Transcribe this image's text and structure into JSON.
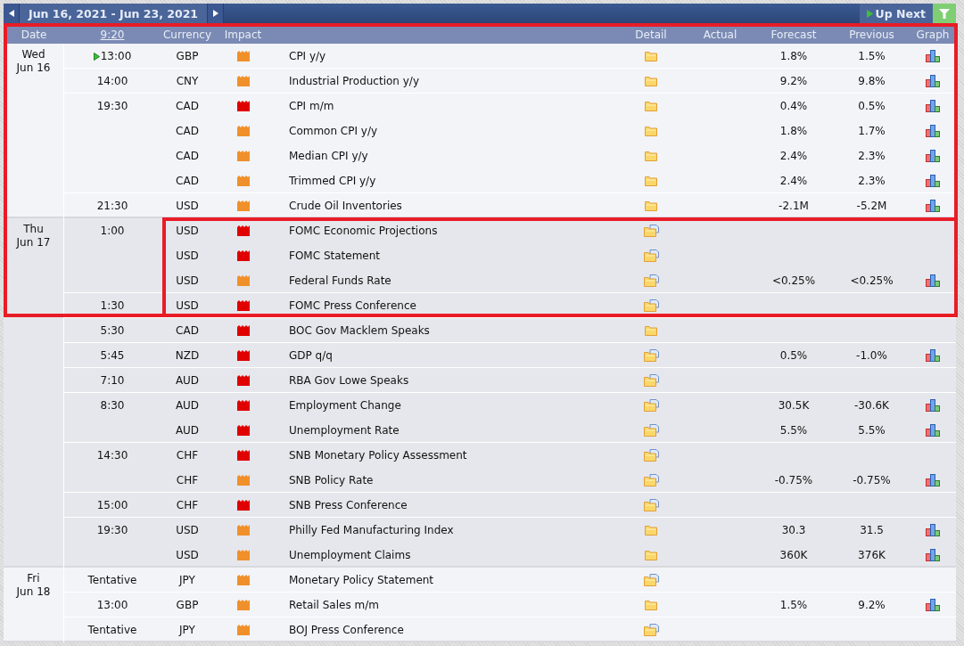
{
  "toolbar": {
    "range": "Jun 16, 2021 - Jun 23, 2021",
    "up_next": "Up Next"
  },
  "columns": {
    "date": "Date",
    "time": "9:20",
    "currency": "Currency",
    "impact": "Impact",
    "detail": "Detail",
    "actual": "Actual",
    "forecast": "Forecast",
    "previous": "Previous",
    "graph": "Graph"
  },
  "days": [
    {
      "weekday": "Wed",
      "date": "Jun 16",
      "groups": [
        {
          "time": "13:00",
          "upcoming": true,
          "events": [
            {
              "currency": "GBP",
              "impact": {
                "color": "#f0902a"
              },
              "title": "CPI y/y",
              "detail": {
                "kind": "folder"
              },
              "forecast": "1.8%",
              "previous": "1.5%",
              "graph": true
            }
          ]
        },
        {
          "time": "14:00",
          "upcoming": false,
          "events": [
            {
              "currency": "CNY",
              "impact": {
                "color": "#f0902a"
              },
              "title": "Industrial Production y/y",
              "detail": {
                "kind": "folder"
              },
              "forecast": "9.2%",
              "previous": "9.8%",
              "graph": true
            }
          ]
        },
        {
          "time": "19:30",
          "upcoming": false,
          "events": [
            {
              "currency": "CAD",
              "impact": {
                "color": "#e00000"
              },
              "title": "CPI m/m",
              "detail": {
                "kind": "folder"
              },
              "forecast": "0.4%",
              "previous": "0.5%",
              "graph": true
            },
            {
              "currency": "CAD",
              "impact": {
                "color": "#f0902a"
              },
              "title": "Common CPI y/y",
              "detail": {
                "kind": "folder"
              },
              "forecast": "1.8%",
              "previous": "1.7%",
              "graph": true
            },
            {
              "currency": "CAD",
              "impact": {
                "color": "#f0902a"
              },
              "title": "Median CPI y/y",
              "detail": {
                "kind": "folder"
              },
              "forecast": "2.4%",
              "previous": "2.3%",
              "graph": true
            },
            {
              "currency": "CAD",
              "impact": {
                "color": "#f0902a"
              },
              "title": "Trimmed CPI y/y",
              "detail": {
                "kind": "folder"
              },
              "forecast": "2.4%",
              "previous": "2.3%",
              "graph": true
            }
          ]
        },
        {
          "time": "21:30",
          "upcoming": false,
          "events": [
            {
              "currency": "USD",
              "impact": {
                "color": "#f0902a"
              },
              "title": "Crude Oil Inventories",
              "detail": {
                "kind": "folder"
              },
              "forecast": "-2.1M",
              "previous": "-5.2M",
              "graph": true
            }
          ]
        }
      ]
    },
    {
      "weekday": "Thu",
      "date": "Jun 17",
      "groups": [
        {
          "time": "1:00",
          "upcoming": false,
          "events": [
            {
              "currency": "USD",
              "impact": {
                "color": "#e00000"
              },
              "title": "FOMC Economic Projections",
              "detail": {
                "kind": "folder-doc"
              },
              "graph": false
            },
            {
              "currency": "USD",
              "impact": {
                "color": "#e00000"
              },
              "title": "FOMC Statement",
              "detail": {
                "kind": "folder-doc"
              },
              "graph": false
            },
            {
              "currency": "USD",
              "impact": {
                "color": "#f0902a"
              },
              "title": "Federal Funds Rate",
              "detail": {
                "kind": "folder-doc"
              },
              "forecast": "<0.25%",
              "previous": "<0.25%",
              "graph": true
            }
          ]
        },
        {
          "time": "1:30",
          "upcoming": false,
          "events": [
            {
              "currency": "USD",
              "impact": {
                "color": "#e00000"
              },
              "title": "FOMC Press Conference",
              "detail": {
                "kind": "folder-doc"
              },
              "graph": false
            }
          ]
        },
        {
          "time": "5:30",
          "upcoming": false,
          "events": [
            {
              "currency": "CAD",
              "impact": {
                "color": "#e00000"
              },
              "title": "BOC Gov Macklem Speaks",
              "detail": {
                "kind": "folder"
              },
              "graph": false
            }
          ]
        },
        {
          "time": "5:45",
          "upcoming": false,
          "events": [
            {
              "currency": "NZD",
              "impact": {
                "color": "#e00000"
              },
              "title": "GDP q/q",
              "detail": {
                "kind": "folder-doc"
              },
              "forecast": "0.5%",
              "previous": "-1.0%",
              "graph": true
            }
          ]
        },
        {
          "time": "7:10",
          "upcoming": false,
          "events": [
            {
              "currency": "AUD",
              "impact": {
                "color": "#e00000"
              },
              "title": "RBA Gov Lowe Speaks",
              "detail": {
                "kind": "folder-doc"
              },
              "graph": false
            }
          ]
        },
        {
          "time": "8:30",
          "upcoming": false,
          "events": [
            {
              "currency": "AUD",
              "impact": {
                "color": "#e00000"
              },
              "title": "Employment Change",
              "detail": {
                "kind": "folder-doc"
              },
              "forecast": "30.5K",
              "previous": "-30.6K",
              "graph": true
            },
            {
              "currency": "AUD",
              "impact": {
                "color": "#e00000"
              },
              "title": "Unemployment Rate",
              "detail": {
                "kind": "folder-doc"
              },
              "forecast": "5.5%",
              "previous": "5.5%",
              "graph": true
            }
          ]
        },
        {
          "time": "14:30",
          "upcoming": false,
          "events": [
            {
              "currency": "CHF",
              "impact": {
                "color": "#e00000"
              },
              "title": "SNB Monetary Policy Assessment",
              "detail": {
                "kind": "folder-doc"
              },
              "graph": false
            },
            {
              "currency": "CHF",
              "impact": {
                "color": "#f0902a"
              },
              "title": "SNB Policy Rate",
              "detail": {
                "kind": "folder-doc"
              },
              "forecast": "-0.75%",
              "previous": "-0.75%",
              "graph": true
            }
          ]
        },
        {
          "time": "15:00",
          "upcoming": false,
          "events": [
            {
              "currency": "CHF",
              "impact": {
                "color": "#e00000"
              },
              "title": "SNB Press Conference",
              "detail": {
                "kind": "folder-doc"
              },
              "graph": false
            }
          ]
        },
        {
          "time": "19:30",
          "upcoming": false,
          "events": [
            {
              "currency": "USD",
              "impact": {
                "color": "#f0902a"
              },
              "title": "Philly Fed Manufacturing Index",
              "detail": {
                "kind": "folder"
              },
              "forecast": "30.3",
              "previous": "31.5",
              "graph": true
            },
            {
              "currency": "USD",
              "impact": {
                "color": "#f0902a"
              },
              "title": "Unemployment Claims",
              "detail": {
                "kind": "folder"
              },
              "forecast": "360K",
              "previous": "376K",
              "graph": true
            }
          ]
        }
      ]
    },
    {
      "weekday": "Fri",
      "date": "Jun 18",
      "groups": [
        {
          "time": "Tentative",
          "upcoming": false,
          "events": [
            {
              "currency": "JPY",
              "impact": {
                "color": "#f0902a"
              },
              "title": "Monetary Policy Statement",
              "detail": {
                "kind": "folder-doc"
              },
              "graph": false
            }
          ]
        },
        {
          "time": "13:00",
          "upcoming": false,
          "events": [
            {
              "currency": "GBP",
              "impact": {
                "color": "#f0902a"
              },
              "title": "Retail Sales m/m",
              "detail": {
                "kind": "folder"
              },
              "forecast": "1.5%",
              "previous": "9.2%",
              "graph": true
            }
          ]
        },
        {
          "time": "Tentative",
          "upcoming": false,
          "events": [
            {
              "currency": "JPY",
              "impact": {
                "color": "#f0902a"
              },
              "title": "BOJ Press Conference",
              "detail": {
                "kind": "folder-doc"
              },
              "graph": false
            }
          ]
        }
      ]
    }
  ]
}
